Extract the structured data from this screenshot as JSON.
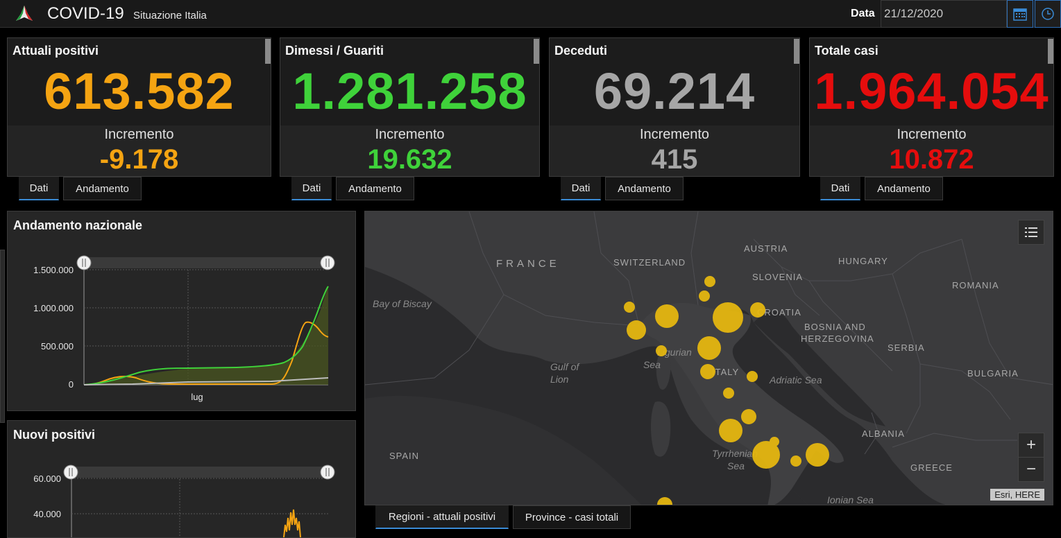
{
  "header": {
    "title": "COVID-19",
    "subtitle": "Situazione Italia",
    "date_label": "Data",
    "date_value": "21/12/2020"
  },
  "cards": [
    {
      "title": "Attuali positivi",
      "value": "613.582",
      "inc_label": "Incremento",
      "inc": "-9.178",
      "color": "#f5a412",
      "tabs": [
        "Dati",
        "Andamento"
      ]
    },
    {
      "title": "Dimessi / Guariti",
      "value": "1.281.258",
      "inc_label": "Incremento",
      "inc": "19.632",
      "color": "#3fd23a",
      "tabs": [
        "Dati",
        "Andamento"
      ]
    },
    {
      "title": "Deceduti",
      "value": "69.214",
      "inc_label": "Incremento",
      "inc": "415",
      "color": "#a6a6a6",
      "tabs": [
        "Dati",
        "Andamento"
      ]
    },
    {
      "title": "Totale casi",
      "value": "1.964.054",
      "inc_label": "Incremento",
      "inc": "10.872",
      "color": "#e50d0d",
      "tabs": [
        "Dati",
        "Andamento"
      ]
    }
  ],
  "national": {
    "title": "Andamento nazionale",
    "yticks": [
      "1.500.000",
      "1.000.000",
      "500.000",
      "0"
    ],
    "xtick": "lug"
  },
  "new_positives": {
    "title": "Nuovi positivi",
    "yticks": [
      "60.000",
      "40.000"
    ]
  },
  "map": {
    "labels": {
      "france": "FRANCE",
      "switzerland": "SWITZERLAND",
      "austria": "AUSTRIA",
      "hungary": "HUNGARY",
      "slovenia": "SLOVENIA",
      "croatia": "CROATIA",
      "romania": "ROMANIA",
      "bosnia1": "BOSNIA AND",
      "bosnia2": "HERZEGOVINA",
      "serbia": "SERBIA",
      "bulgaria": "BULGARIA",
      "italy": "ITALY",
      "albania": "ALBANIA",
      "greece": "GREECE",
      "spain": "SPAIN"
    },
    "seas": {
      "biscay": "Bay of Biscay",
      "ligurian1": "Ligurian",
      "ligurian2": "Sea",
      "lion1": "Gulf of",
      "lion2": "Lion",
      "adriatic": "Adriatic Sea",
      "tyrrhenian1": "Tyrrhenian",
      "tyrrhenian2": "Sea",
      "ionian": "Ionian Sea"
    },
    "zoom_in": "+",
    "zoom_out": "−",
    "attribution": "Esri, HERE",
    "bubble_color": "#e8b90f",
    "tabs": [
      "Regioni - attuali positivi",
      "Province - casi totali"
    ]
  },
  "icons": {
    "logo": "italy-star-logo-icon",
    "calendar": "calendar-icon",
    "clock": "clock-icon",
    "legend": "legend-list-icon"
  }
}
